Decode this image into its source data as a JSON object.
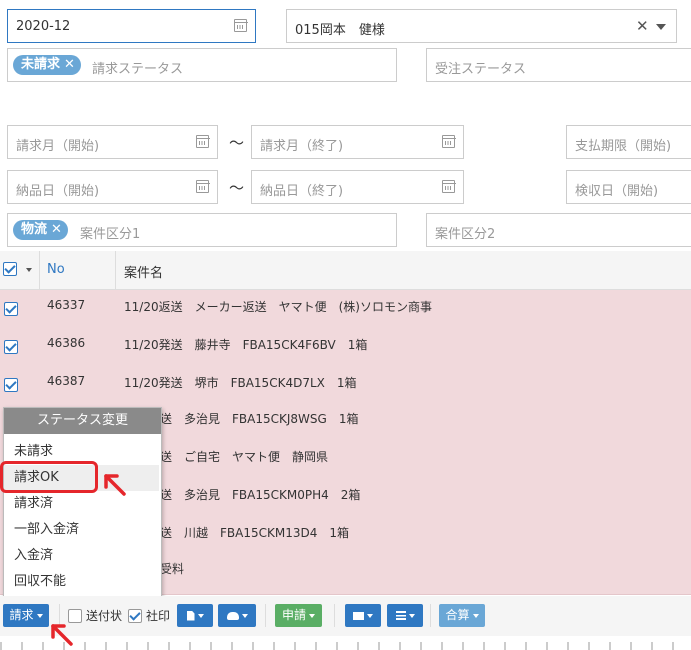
{
  "filters": {
    "month_value": "2020-12",
    "person_value": "015岡本　健様",
    "billing_status": {
      "tag": "未請求",
      "placeholder": "請求ステータス"
    },
    "order_status_placeholder": "受注ステータス",
    "bill_month_start": "請求月（開始)",
    "bill_month_end": "請求月（終了)",
    "pay_deadline_start": "支払期限（開始)",
    "delivery_start": "納品日（開始)",
    "delivery_end": "納品日（終了)",
    "inspection_start": "検収日（開始)",
    "category1": {
      "tag": "物流",
      "placeholder": "案件区分1"
    },
    "category2_placeholder": "案件区分2",
    "tilde": "～"
  },
  "grid": {
    "col_no": "No",
    "col_name": "案件名",
    "rows": [
      {
        "no": "46337",
        "name": "11/20返送　メーカー返送　ヤマト便　(株)ソロモン商事"
      },
      {
        "no": "46386",
        "name": "11/20発送　藤井寺　FBA15CK4F6BV　1箱"
      },
      {
        "no": "46387",
        "name": "11/20発送　堺市　FBA15CK4D7LX　1箱"
      },
      {
        "no": "",
        "name": "送　多治見　FBA15CKJ8WSG　1箱"
      },
      {
        "no": "",
        "name": "送　ご自宅　ヤマト便　静岡県"
      },
      {
        "no": "",
        "name": "送　多治見　FBA15CKM0PH4　2箱"
      },
      {
        "no": "",
        "name": "送　川越　FBA15CKM13D4　1箱"
      },
      {
        "no": "",
        "name": "受料"
      }
    ]
  },
  "status_menu": {
    "title": "ステータス変更",
    "items": [
      "未請求",
      "請求OK",
      "請求済",
      "一部入金済",
      "入金済",
      "回収不能"
    ]
  },
  "toolbar": {
    "billing_label": "請求",
    "send_slip_label": "送付状",
    "company_seal_label": "社印",
    "apply_label": "申請",
    "total_label": "合算"
  },
  "colors": {
    "accent": "#2f78c2",
    "highlight": "#e5262b",
    "row_bg": "#f1d9dc",
    "apply_green": "#5aae65"
  }
}
